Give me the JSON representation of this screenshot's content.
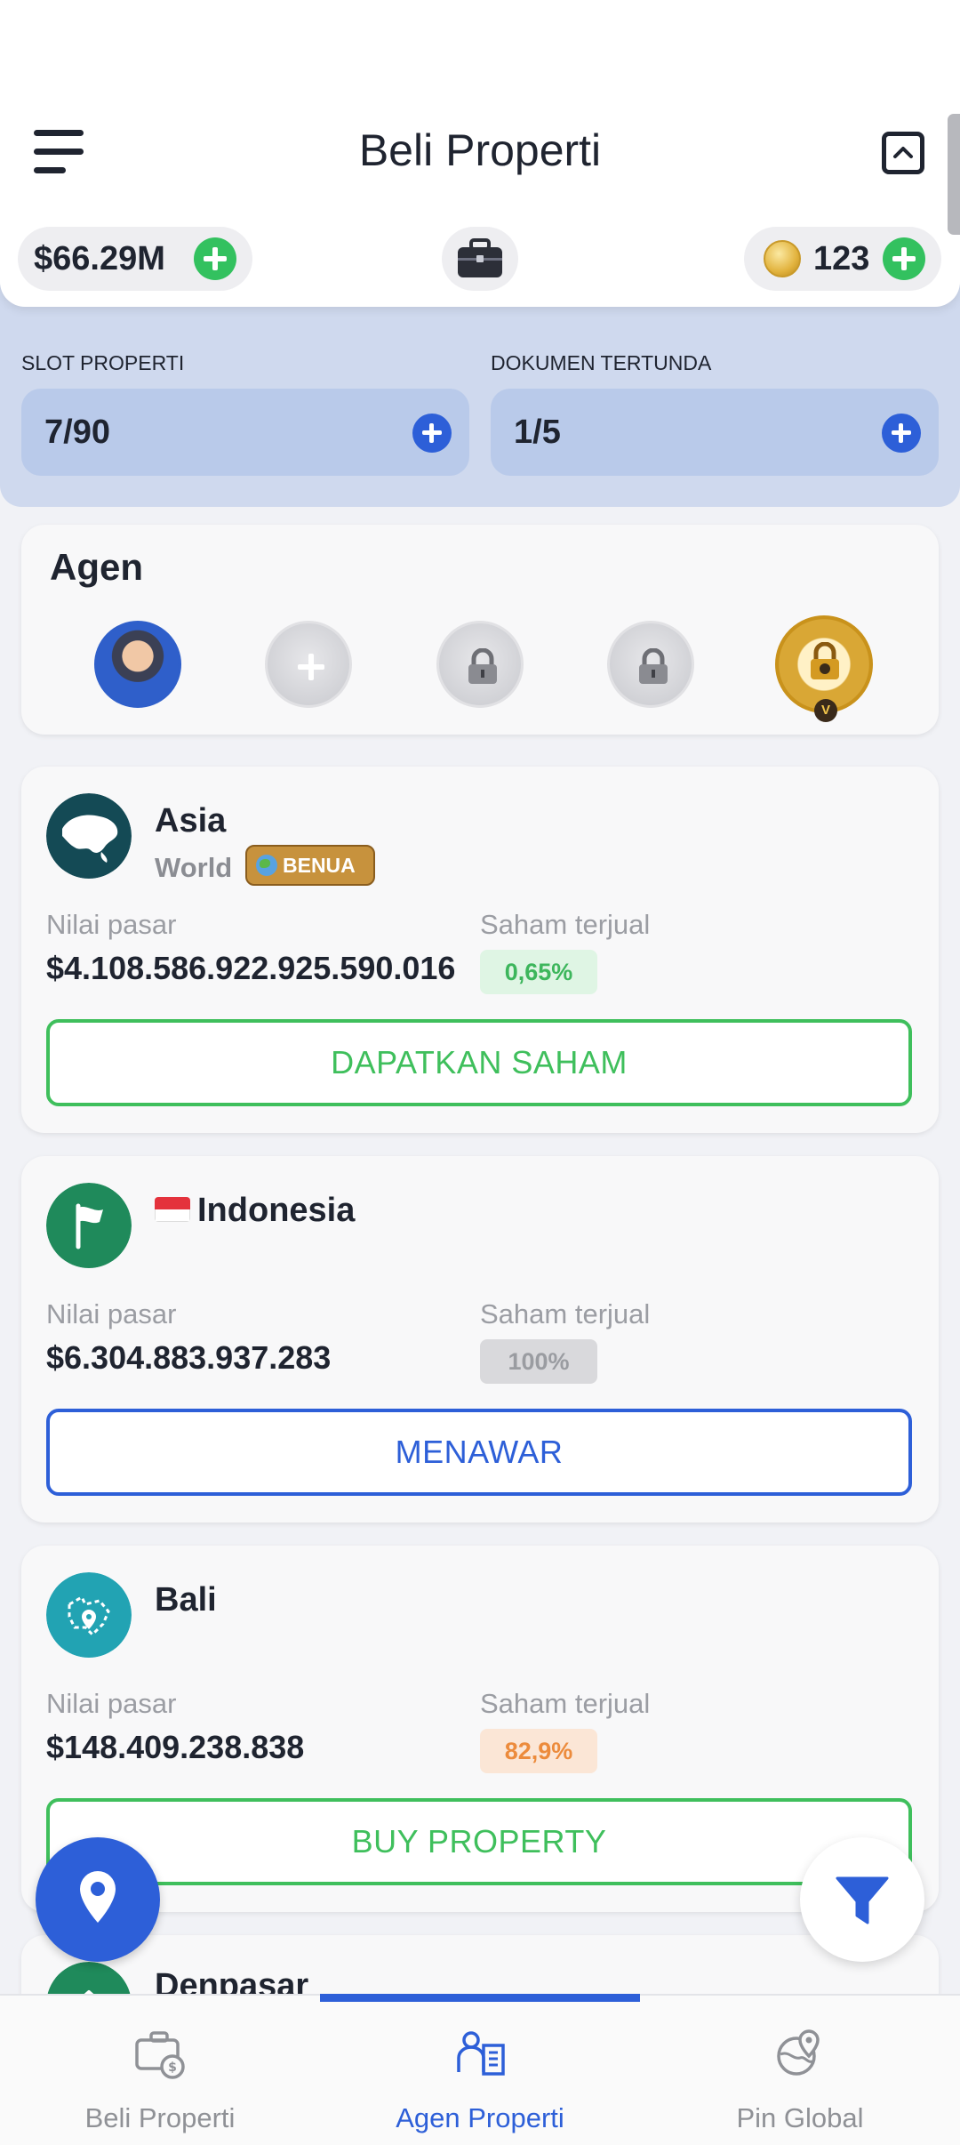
{
  "header": {
    "title": "Beli Properti",
    "money": "$66.29M",
    "coins": "123"
  },
  "slots": {
    "property_label": "SLOT PROPERTI",
    "property_value": "7/90",
    "docs_label": "DOKUMEN TERTUNDA",
    "docs_value": "1/5"
  },
  "agents": {
    "title": "Agen"
  },
  "properties": [
    {
      "name": "Asia",
      "sub": "World",
      "tag": "BENUA",
      "market_label": "Nilai pasar",
      "market_value": "$4.108.586.922.925.590.016",
      "sold_label": "Saham terjual",
      "sold_value": "0,65%",
      "action": "DAPATKAN SAHAM"
    },
    {
      "name": "Indonesia",
      "market_label": "Nilai pasar",
      "market_value": "$6.304.883.937.283",
      "sold_label": "Saham terjual",
      "sold_value": "100%",
      "action": "MENAWAR"
    },
    {
      "name": "Bali",
      "market_label": "Nilai pasar",
      "market_value": "$148.409.238.838",
      "sold_label": "Saham terjual",
      "sold_value": "82,9%",
      "action": "BUY PROPERTY"
    },
    {
      "name": "Denpasar"
    }
  ],
  "nav": {
    "items": [
      {
        "label": "Beli Properti",
        "icon": "briefcase-dollar-icon"
      },
      {
        "label": "Agen Properti",
        "icon": "agent-building-icon",
        "active": true
      },
      {
        "label": "Pin Global",
        "icon": "globe-pin-icon"
      }
    ]
  },
  "colors": {
    "primary": "#2d5fd8",
    "success": "#3fbf5c",
    "warning": "#ec8b3c",
    "band": "#cfd9ee"
  }
}
